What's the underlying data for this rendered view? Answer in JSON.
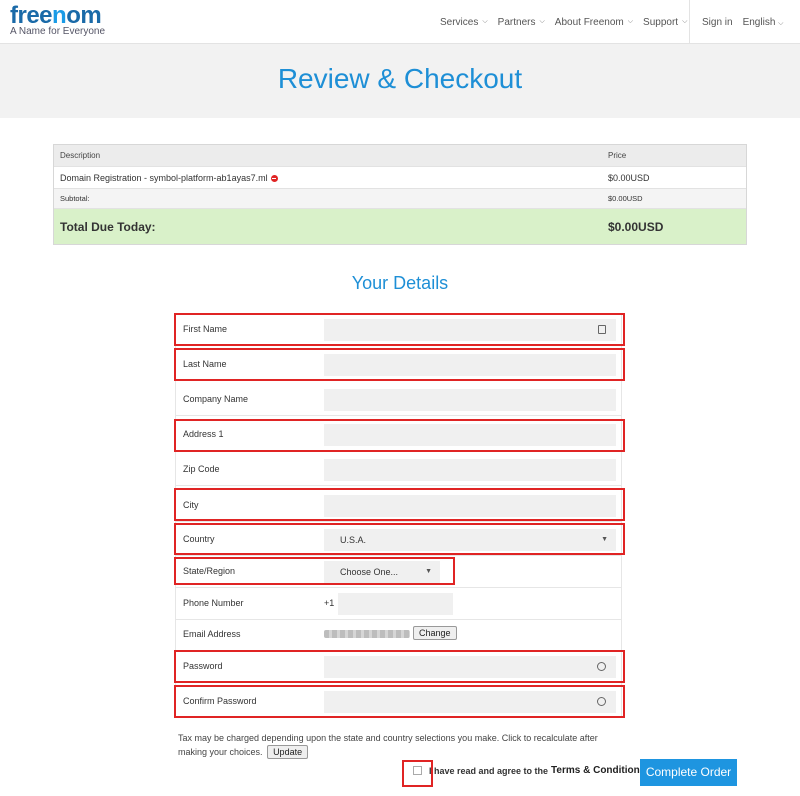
{
  "header": {
    "logo_text_pre": "free",
    "logo_text_o": "n",
    "logo_text_post": "om",
    "tagline": "A Name for Everyone",
    "nav": [
      {
        "label": "Services"
      },
      {
        "label": "Partners"
      },
      {
        "label": "About Freenom"
      },
      {
        "label": "Support"
      }
    ],
    "sign_in": "Sign in",
    "language": "English"
  },
  "page_title": "Review & Checkout",
  "order_table": {
    "col_description": "Description",
    "col_price": "Price",
    "item_description": "Domain Registration - symbol-platform-ab1ayas7.ml",
    "item_price": "$0.00USD",
    "subtotal_label": "Subtotal:",
    "subtotal_value": "$0.00USD",
    "total_label": "Total Due Today:",
    "total_value": "$0.00USD"
  },
  "details_title": "Your Details",
  "form": {
    "first_name": {
      "label": "First Name",
      "value": ""
    },
    "last_name": {
      "label": "Last Name",
      "value": ""
    },
    "company_name": {
      "label": "Company Name",
      "value": ""
    },
    "address1": {
      "label": "Address 1",
      "value": ""
    },
    "zip": {
      "label": "Zip Code",
      "value": ""
    },
    "city": {
      "label": "City",
      "value": ""
    },
    "country": {
      "label": "Country",
      "value": "U.S.A."
    },
    "state": {
      "label": "State/Region",
      "value": "Choose One..."
    },
    "phone": {
      "label": "Phone Number",
      "prefix": "+1",
      "value": ""
    },
    "email": {
      "label": "Email Address",
      "change_label": "Change"
    },
    "password": {
      "label": "Password",
      "value": ""
    },
    "confirm_password": {
      "label": "Confirm Password",
      "value": ""
    }
  },
  "tax_note": "Tax may be charged depending upon the state and country selections you make. Click to recalculate after making your choices.",
  "update_label": "Update",
  "agree_text": "I have read and agree to the",
  "terms_link": "Terms & Conditions",
  "complete_order": "Complete Order",
  "colors": {
    "accent": "#1e95e0",
    "highlight": "#e02424",
    "total_bg": "#d9f1c9"
  }
}
